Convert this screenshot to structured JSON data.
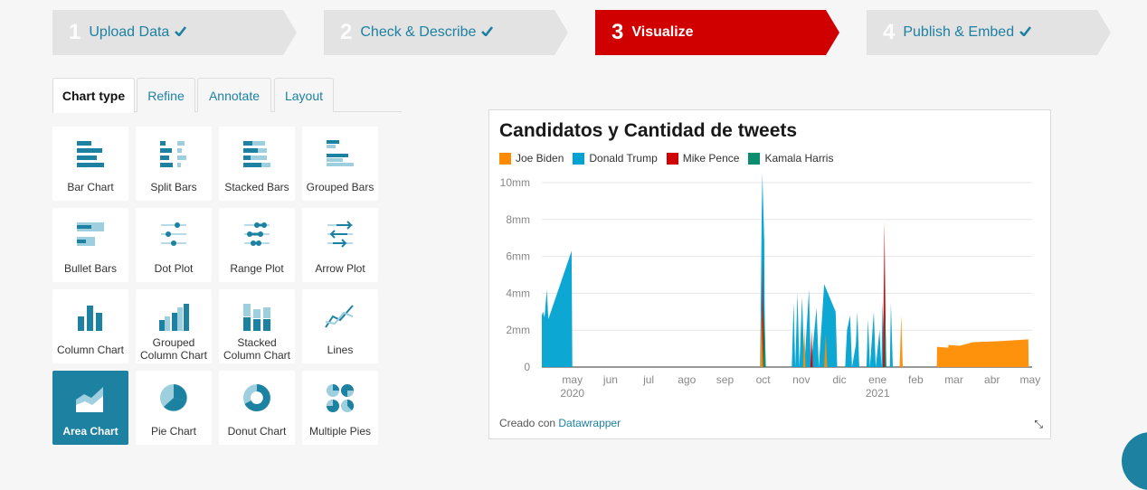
{
  "steps": [
    {
      "num": "1",
      "label": "Upload Data",
      "done": true
    },
    {
      "num": "2",
      "label": "Check & Describe",
      "done": true
    },
    {
      "num": "3",
      "label": "Visualize",
      "done": false
    },
    {
      "num": "4",
      "label": "Publish & Embed",
      "done": true
    }
  ],
  "tabs": [
    "Chart type",
    "Refine",
    "Annotate",
    "Layout"
  ],
  "chart_types": [
    {
      "label": "Bar Chart",
      "icon": "bar-chart-icon"
    },
    {
      "label": "Split Bars",
      "icon": "split-bars-icon"
    },
    {
      "label": "Stacked Bars",
      "icon": "stacked-bars-icon"
    },
    {
      "label": "Grouped Bars",
      "icon": "grouped-bars-icon"
    },
    {
      "label": "Bullet Bars",
      "icon": "bullet-bars-icon"
    },
    {
      "label": "Dot Plot",
      "icon": "dot-plot-icon"
    },
    {
      "label": "Range Plot",
      "icon": "range-plot-icon"
    },
    {
      "label": "Arrow Plot",
      "icon": "arrow-plot-icon"
    },
    {
      "label": "Column Chart",
      "icon": "column-chart-icon"
    },
    {
      "label": "Grouped Column Chart",
      "icon": "grouped-column-chart-icon"
    },
    {
      "label": "Stacked Column Chart",
      "icon": "stacked-column-chart-icon"
    },
    {
      "label": "Lines",
      "icon": "lines-icon"
    },
    {
      "label": "Area Chart",
      "icon": "area-chart-icon",
      "selected": true
    },
    {
      "label": "Pie Chart",
      "icon": "pie-chart-icon"
    },
    {
      "label": "Donut Chart",
      "icon": "donut-chart-icon"
    },
    {
      "label": "Multiple Pies",
      "icon": "multiple-pies-icon"
    }
  ],
  "colors": {
    "accent": "#1d81a2",
    "active_step": "#d00000",
    "step_bg": "#e3e3e3",
    "icon_dark": "#1d81a2",
    "icon_light": "#9dcfdf"
  },
  "chart_data": {
    "type": "area",
    "title": "Candidatos y Cantidad de tweets",
    "legend": [
      {
        "name": "Joe Biden",
        "color": "#ff8c00"
      },
      {
        "name": "Donald Trump",
        "color": "#00a2d1"
      },
      {
        "name": "Mike Pence",
        "color": "#d00000"
      },
      {
        "name": "Kamala Harris",
        "color": "#0a8c6e"
      }
    ],
    "yticks": [
      "0",
      "2mm",
      "4mm",
      "6mm",
      "8mm",
      "10mm"
    ],
    "ylim": [
      0,
      10
    ],
    "xticks": [
      {
        "m": 1,
        "label": "may",
        "year": "2020"
      },
      {
        "m": 2,
        "label": "jun"
      },
      {
        "m": 3,
        "label": "jul"
      },
      {
        "m": 4,
        "label": "ago"
      },
      {
        "m": 5,
        "label": "sep"
      },
      {
        "m": 6,
        "label": "oct"
      },
      {
        "m": 7,
        "label": "nov"
      },
      {
        "m": 8,
        "label": "dic"
      },
      {
        "m": 9,
        "label": "ene",
        "year": "2021"
      },
      {
        "m": 10,
        "label": "feb"
      },
      {
        "m": 11,
        "label": "mar"
      },
      {
        "m": 12,
        "label": "abr"
      },
      {
        "m": 13,
        "label": "may"
      }
    ],
    "xlim": [
      0.2,
      13.05
    ],
    "series": [
      {
        "name": "Donald Trump",
        "color": "#00a2d1",
        "points": [
          [
            0.0,
            0
          ],
          [
            0.1,
            0
          ],
          [
            0.12,
            4.2
          ],
          [
            0.18,
            2.8
          ],
          [
            0.23,
            3.0
          ],
          [
            0.27,
            2.7
          ],
          [
            0.33,
            4.2
          ],
          [
            0.37,
            2.6
          ],
          [
            0.98,
            6.3
          ],
          [
            1.0,
            0
          ],
          [
            5.92,
            0
          ],
          [
            5.96,
            8.0
          ],
          [
            5.98,
            10.5
          ],
          [
            6.03,
            6.8
          ],
          [
            6.05,
            0
          ],
          [
            6.75,
            0
          ],
          [
            6.8,
            3.5
          ],
          [
            6.84,
            0
          ],
          [
            6.9,
            4.0
          ],
          [
            6.95,
            0
          ],
          [
            7.02,
            3.8
          ],
          [
            7.08,
            0
          ],
          [
            7.2,
            4.2
          ],
          [
            7.25,
            0
          ],
          [
            7.4,
            3.2
          ],
          [
            7.46,
            0
          ],
          [
            7.6,
            4.5
          ],
          [
            7.9,
            3.0
          ],
          [
            7.94,
            0
          ],
          [
            8.15,
            0
          ],
          [
            8.2,
            2.0
          ],
          [
            8.28,
            2.8
          ],
          [
            8.33,
            0
          ],
          [
            8.43,
            1.2
          ],
          [
            8.47,
            3.0
          ],
          [
            8.52,
            0
          ],
          [
            8.71,
            0
          ],
          [
            8.75,
            2.6
          ],
          [
            8.8,
            0
          ],
          [
            8.9,
            3.0
          ],
          [
            8.95,
            0
          ],
          [
            9.05,
            2.0
          ],
          [
            9.1,
            0
          ],
          [
            9.13,
            3.6
          ],
          [
            9.18,
            0
          ],
          [
            9.32,
            0
          ],
          [
            9.35,
            3.5
          ],
          [
            9.4,
            0
          ]
        ]
      },
      {
        "name": "Mike Pence",
        "color": "#d00000",
        "points": [
          [
            5.96,
            0
          ],
          [
            5.99,
            6.0
          ],
          [
            6.02,
            0
          ],
          [
            9.14,
            0
          ],
          [
            9.18,
            7.9
          ],
          [
            9.22,
            0
          ],
          [
            7.24,
            0
          ],
          [
            7.27,
            2.0
          ],
          [
            7.3,
            0
          ]
        ]
      },
      {
        "name": "Kamala Harris",
        "color": "#0a8c6e",
        "points": [
          [
            6.0,
            0
          ],
          [
            6.03,
            3.5
          ],
          [
            6.07,
            0
          ],
          [
            9.18,
            0
          ],
          [
            9.2,
            3.0
          ],
          [
            9.23,
            0
          ]
        ]
      },
      {
        "name": "Joe Biden",
        "color": "#ff8c00",
        "points": [
          [
            0.02,
            0
          ],
          [
            0.04,
            1.8
          ],
          [
            0.06,
            0
          ],
          [
            5.93,
            0
          ],
          [
            5.96,
            3.2
          ],
          [
            6.0,
            0
          ],
          [
            7.05,
            0
          ],
          [
            7.08,
            2.2
          ],
          [
            7.11,
            0
          ],
          [
            7.6,
            0
          ],
          [
            7.64,
            1.8
          ],
          [
            7.68,
            0
          ],
          [
            9.58,
            0
          ],
          [
            9.62,
            2.8
          ],
          [
            9.66,
            0
          ],
          [
            10.55,
            0
          ],
          [
            10.56,
            1.1
          ],
          [
            10.85,
            1.05
          ],
          [
            10.86,
            1.2
          ],
          [
            11.15,
            1.15
          ],
          [
            11.5,
            1.35
          ],
          [
            12.2,
            1.4
          ],
          [
            12.95,
            1.5
          ],
          [
            12.96,
            0
          ]
        ]
      }
    ]
  },
  "footer": {
    "credit_prefix": "Creado con",
    "credit_link": "Datawrapper"
  }
}
